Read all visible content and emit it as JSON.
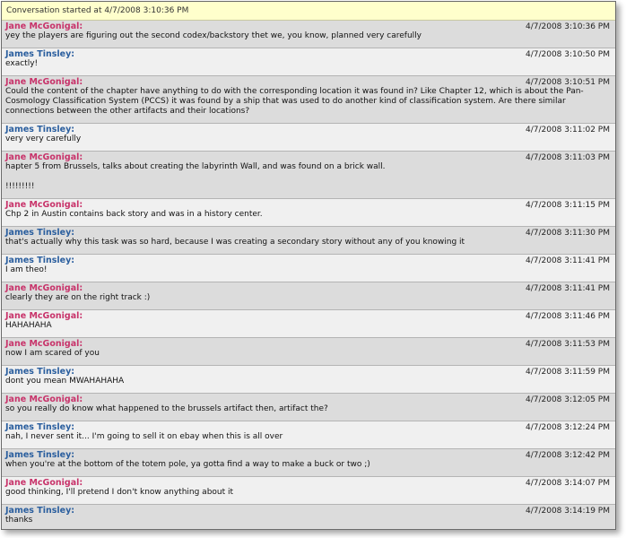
{
  "header": {
    "title": "Conversation started at 4/7/2008 3:10:36 PM"
  },
  "messages": [
    {
      "sender": "Jane McGonigal:",
      "who": "jane",
      "time": "4/7/2008 3:10:36 PM",
      "text": "yey the players are figuring out the second codex/backstory thet we, you know, planned very carefully"
    },
    {
      "sender": "James Tinsley:",
      "who": "james",
      "time": "4/7/2008 3:10:50 PM",
      "text": "exactly!"
    },
    {
      "sender": "Jane McGonigal:",
      "who": "jane",
      "time": "4/7/2008 3:10:51 PM",
      "text": "Could the content of the chapter have anything to do with the corresponding location it was found in? Like Chapter 12, which is about the Pan-Cosmology Classification System (PCCS)  it was found by a ship that was used to do another kind of classification system. Are there similar connections between the other artifacts and their locations?"
    },
    {
      "sender": "James Tinsley:",
      "who": "james",
      "time": "4/7/2008 3:11:02 PM",
      "text": "very very carefully"
    },
    {
      "sender": "Jane McGonigal:",
      "who": "jane",
      "time": "4/7/2008 3:11:03 PM",
      "text": "hapter 5 from Brussels, talks about creating the labyrinth Wall, and was found on a brick wall.\n\n!!!!!!!!!"
    },
    {
      "sender": "Jane McGonigal:",
      "who": "jane",
      "time": "4/7/2008 3:11:15 PM",
      "text": "Chp 2 in Austin contains back story and was in a history center."
    },
    {
      "sender": "James Tinsley:",
      "who": "james",
      "time": "4/7/2008 3:11:30 PM",
      "text": "that's actually why this task was so hard, because I was creating a secondary story without any of you knowing it"
    },
    {
      "sender": "James Tinsley:",
      "who": "james",
      "time": "4/7/2008 3:11:41 PM",
      "text": "I am theo!"
    },
    {
      "sender": "Jane McGonigal:",
      "who": "jane",
      "time": "4/7/2008 3:11:41 PM",
      "text": "clearly they are on the right track :)"
    },
    {
      "sender": "Jane McGonigal:",
      "who": "jane",
      "time": "4/7/2008 3:11:46 PM",
      "text": "HAHAHAHA"
    },
    {
      "sender": "Jane McGonigal:",
      "who": "jane",
      "time": "4/7/2008 3:11:53 PM",
      "text": "now I am scared of you"
    },
    {
      "sender": "James Tinsley:",
      "who": "james",
      "time": "4/7/2008 3:11:59 PM",
      "text": "dont you mean MWAHAHAHA"
    },
    {
      "sender": "Jane McGonigal:",
      "who": "jane",
      "time": "4/7/2008 3:12:05 PM",
      "text": "so you really do know what happened to the brussels artifact then, artifact the?"
    },
    {
      "sender": "James Tinsley:",
      "who": "james",
      "time": "4/7/2008 3:12:24 PM",
      "text": "nah, I never sent it... I'm going to sell it on ebay when this is all over"
    },
    {
      "sender": "James Tinsley:",
      "who": "james",
      "time": "4/7/2008 3:12:42 PM",
      "text": "when you're at the bottom of the totem pole, ya gotta find a way to make a buck or two ;)"
    },
    {
      "sender": "Jane McGonigal:",
      "who": "jane",
      "time": "4/7/2008 3:14:07 PM",
      "text": "good thinking, I'll pretend I don't know anything about it"
    },
    {
      "sender": "James Tinsley:",
      "who": "james",
      "time": "4/7/2008 3:14:19 PM",
      "text": "thanks"
    }
  ]
}
